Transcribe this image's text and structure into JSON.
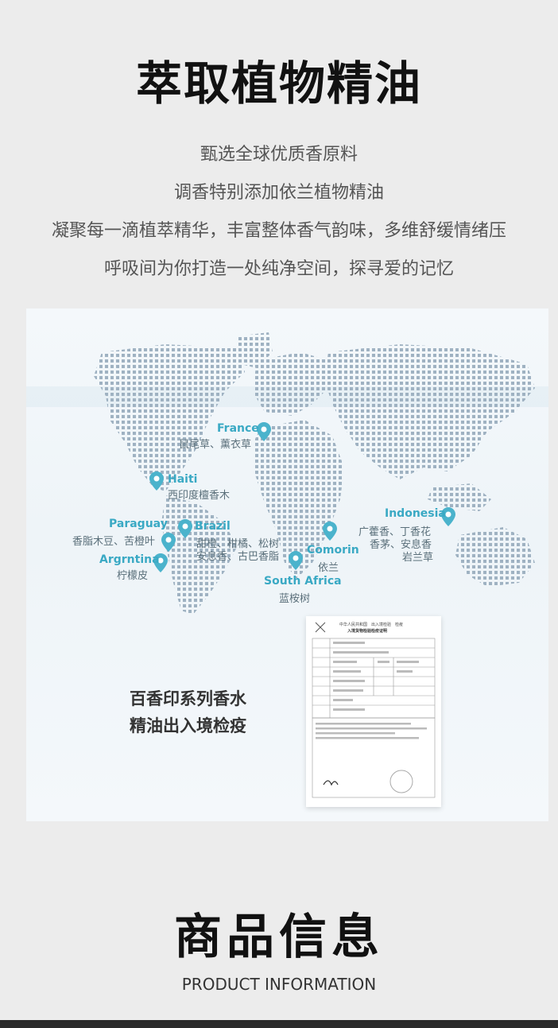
{
  "section": {
    "title": "萃取植物精油",
    "lines": [
      "甄选全球优质香原料",
      "调香特别添加依兰植物精油",
      "凝聚每一滴植萃精华，丰富整体香气韵味，多维舒缓情绪压",
      "呼吸间为你打造一处纯净空间，探寻爱的记忆"
    ]
  },
  "map": {
    "accent_color": "#3aa9c4",
    "locations": [
      {
        "country": "France",
        "plants": "鼠尾草、薰衣草"
      },
      {
        "country": "Haiti",
        "plants": "西印度檀香木"
      },
      {
        "country": "Paraguay",
        "plants": "香脂木豆、苦橙叶"
      },
      {
        "country": "Brazil",
        "plants": "甜橙、柑橘、松树",
        "plants2": "安息香、古巴香脂"
      },
      {
        "country": "Argrntina",
        "plants": "柠檬皮"
      },
      {
        "country": "Comorin",
        "plants": "依兰"
      },
      {
        "country": "South Africa",
        "plants": "蓝桉树"
      },
      {
        "country": "Indonesia",
        "plants": "广藿香、丁香花",
        "plants2": "香茅、安息香",
        "plants3": "岩兰草"
      }
    ]
  },
  "certificate": {
    "caption_line1": "百香印系列香水",
    "caption_line2": "精油出入境检疫",
    "header1": "中华人民共和国　出入境检验　检疫",
    "header2": "入境货物检验检疫证明"
  },
  "product_info": {
    "title": "商品信息",
    "subtitle": "PRODUCT INFORMATION"
  }
}
